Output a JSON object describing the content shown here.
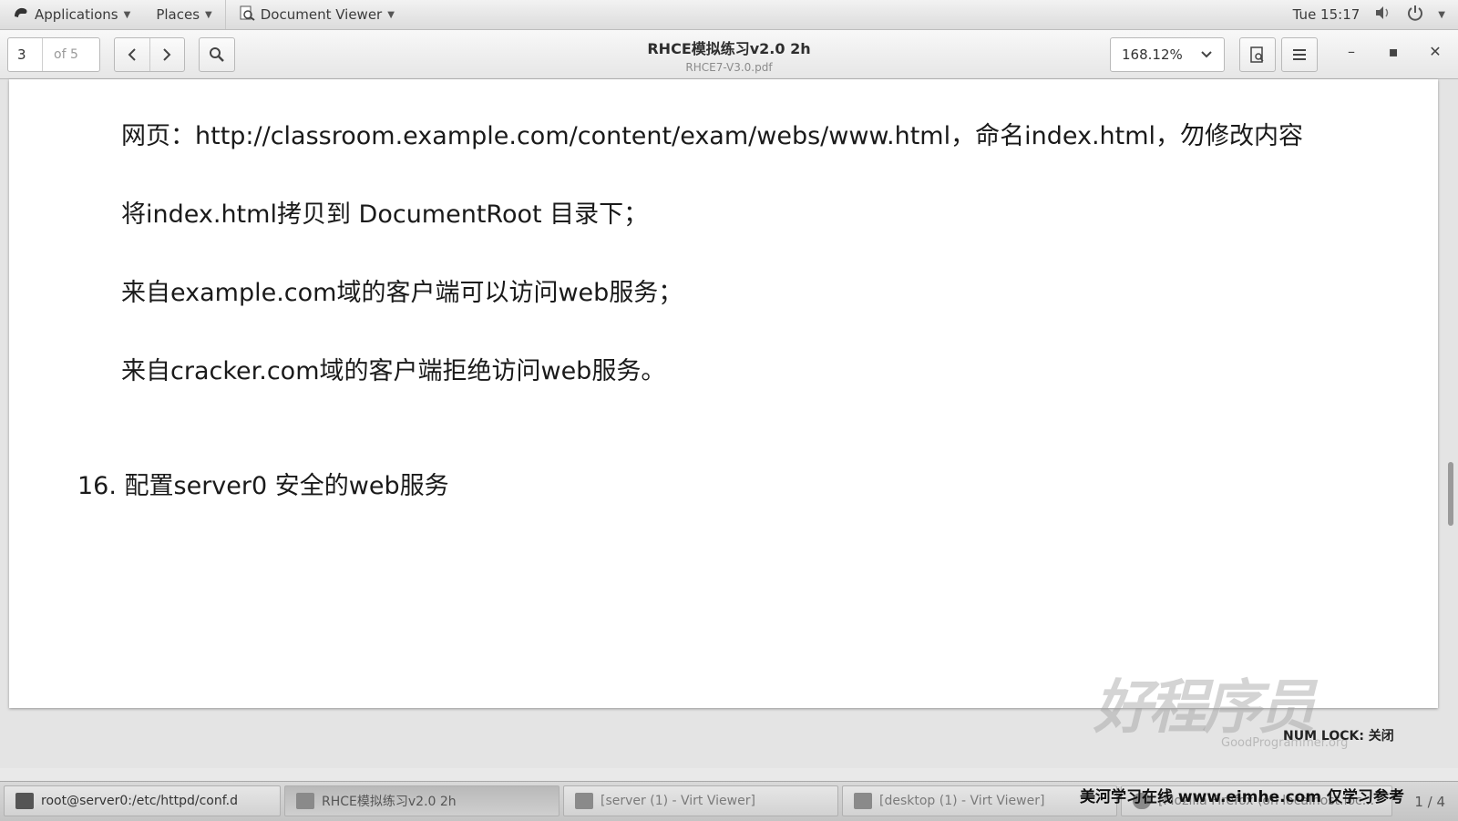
{
  "topbar": {
    "applications": "Applications",
    "places": "Places",
    "app_name": "Document Viewer",
    "clock": "Tue 15:17"
  },
  "header": {
    "page_current": "3",
    "page_of": "of 5",
    "title": "RHCE模拟练习v2.0 2h",
    "subtitle": "RHCE7-V3.0.pdf",
    "zoom": "168.12%"
  },
  "document": {
    "lines": [
      "网页：http://classroom.example.com/content/exam/webs/www.html，命名index.html，勿修改内容",
      "将index.html拷贝到 DocumentRoot 目录下；",
      "来自example.com域的客户端可以访问web服务；",
      "来自cracker.com域的客户端拒绝访问web服务。"
    ],
    "heading": "16. 配置server0 安全的web服务"
  },
  "status": {
    "numlock": "NUM LOCK: 关闭"
  },
  "watermark": {
    "logo": "好程序员",
    "url": "GoodProgrammer.org"
  },
  "taskbar": {
    "tasks": [
      "root@server0:/etc/httpd/conf.d",
      "RHCE模拟练习v2.0 2h",
      "[server (1) - Virt Viewer]",
      "[desktop (1) - Virt Viewer]",
      "[Mozilla Firefox (on localhost.loc..."
    ],
    "pager": "1 / 4",
    "banner": "美河学习在线 www.eimhe.com 仅学习参考"
  }
}
